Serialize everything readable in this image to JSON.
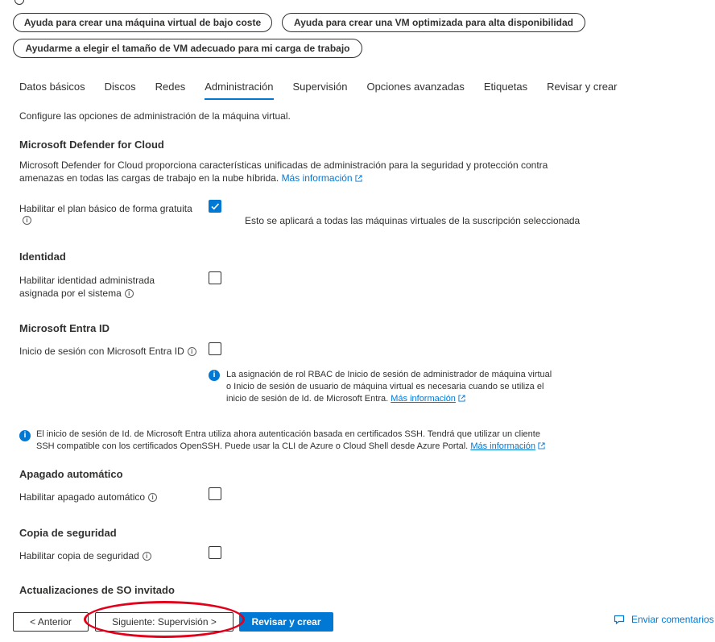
{
  "help_buttons": [
    {
      "label": "Ayuda para crear una máquina virtual de bajo coste"
    },
    {
      "label": "Ayuda para crear una VM optimizada para alta disponibilidad"
    },
    {
      "label": "Ayudarme a elegir el tamaño de VM adecuado para mi carga de trabajo"
    }
  ],
  "tabs": [
    {
      "label": "Datos básicos"
    },
    {
      "label": "Discos"
    },
    {
      "label": "Redes"
    },
    {
      "label": "Administración",
      "active": true
    },
    {
      "label": "Supervisión"
    },
    {
      "label": "Opciones avanzadas"
    },
    {
      "label": "Etiquetas"
    },
    {
      "label": "Revisar y crear"
    }
  ],
  "intro": "Configure las opciones de administración de la máquina virtual.",
  "defender": {
    "heading": "Microsoft Defender for Cloud",
    "description_line1": "Microsoft Defender for Cloud proporciona características unificadas de administración para la seguridad y protección contra",
    "description_line2": "amenazas en todas las cargas de trabajo en la nube híbrida.",
    "more_info": "Más información",
    "enable_label": "Habilitar el plan básico de forma gratuita",
    "enable_checked": true,
    "enable_note": "Esto se aplicará a todas las máquinas virtuales de la suscripción seleccionada"
  },
  "identity": {
    "heading": "Identidad",
    "label_line1": "Habilitar identidad administrada",
    "label_line2": "asignada por el sistema",
    "checked": false
  },
  "entra": {
    "heading": "Microsoft Entra ID",
    "login_label": "Inicio de sesión con Microsoft Entra ID",
    "checked": false,
    "info_line1": "La asignación de rol RBAC de Inicio de sesión de administrador de máquina virtual",
    "info_line2": "o Inicio de sesión de usuario de máquina virtual es necesaria cuando se utiliza el",
    "info_line3": "inicio de sesión de Id. de Microsoft Entra.",
    "info_more": "Más información",
    "ssh_line1": "El inicio de sesión de Id. de Microsoft Entra utiliza ahora autenticación basada en certificados SSH. Tendrá que utilizar un cliente",
    "ssh_line2": "SSH compatible con los certificados OpenSSH. Puede usar la CLI de Azure o Cloud Shell desde Azure Portal.",
    "ssh_more": "Más información"
  },
  "autoshutdown": {
    "heading": "Apagado automático",
    "label": "Habilitar apagado automático",
    "checked": false
  },
  "backup": {
    "heading": "Copia de seguridad",
    "label": "Habilitar copia de seguridad",
    "checked": false
  },
  "guest_updates": {
    "heading": "Actualizaciones de SO invitado"
  },
  "footer": {
    "previous": "< Anterior",
    "next": "Siguiente: Supervisión >",
    "review": "Revisar y crear",
    "feedback": "Enviar comentarios"
  },
  "colors": {
    "accent": "#0078d4",
    "highlight": "#e3001b"
  }
}
